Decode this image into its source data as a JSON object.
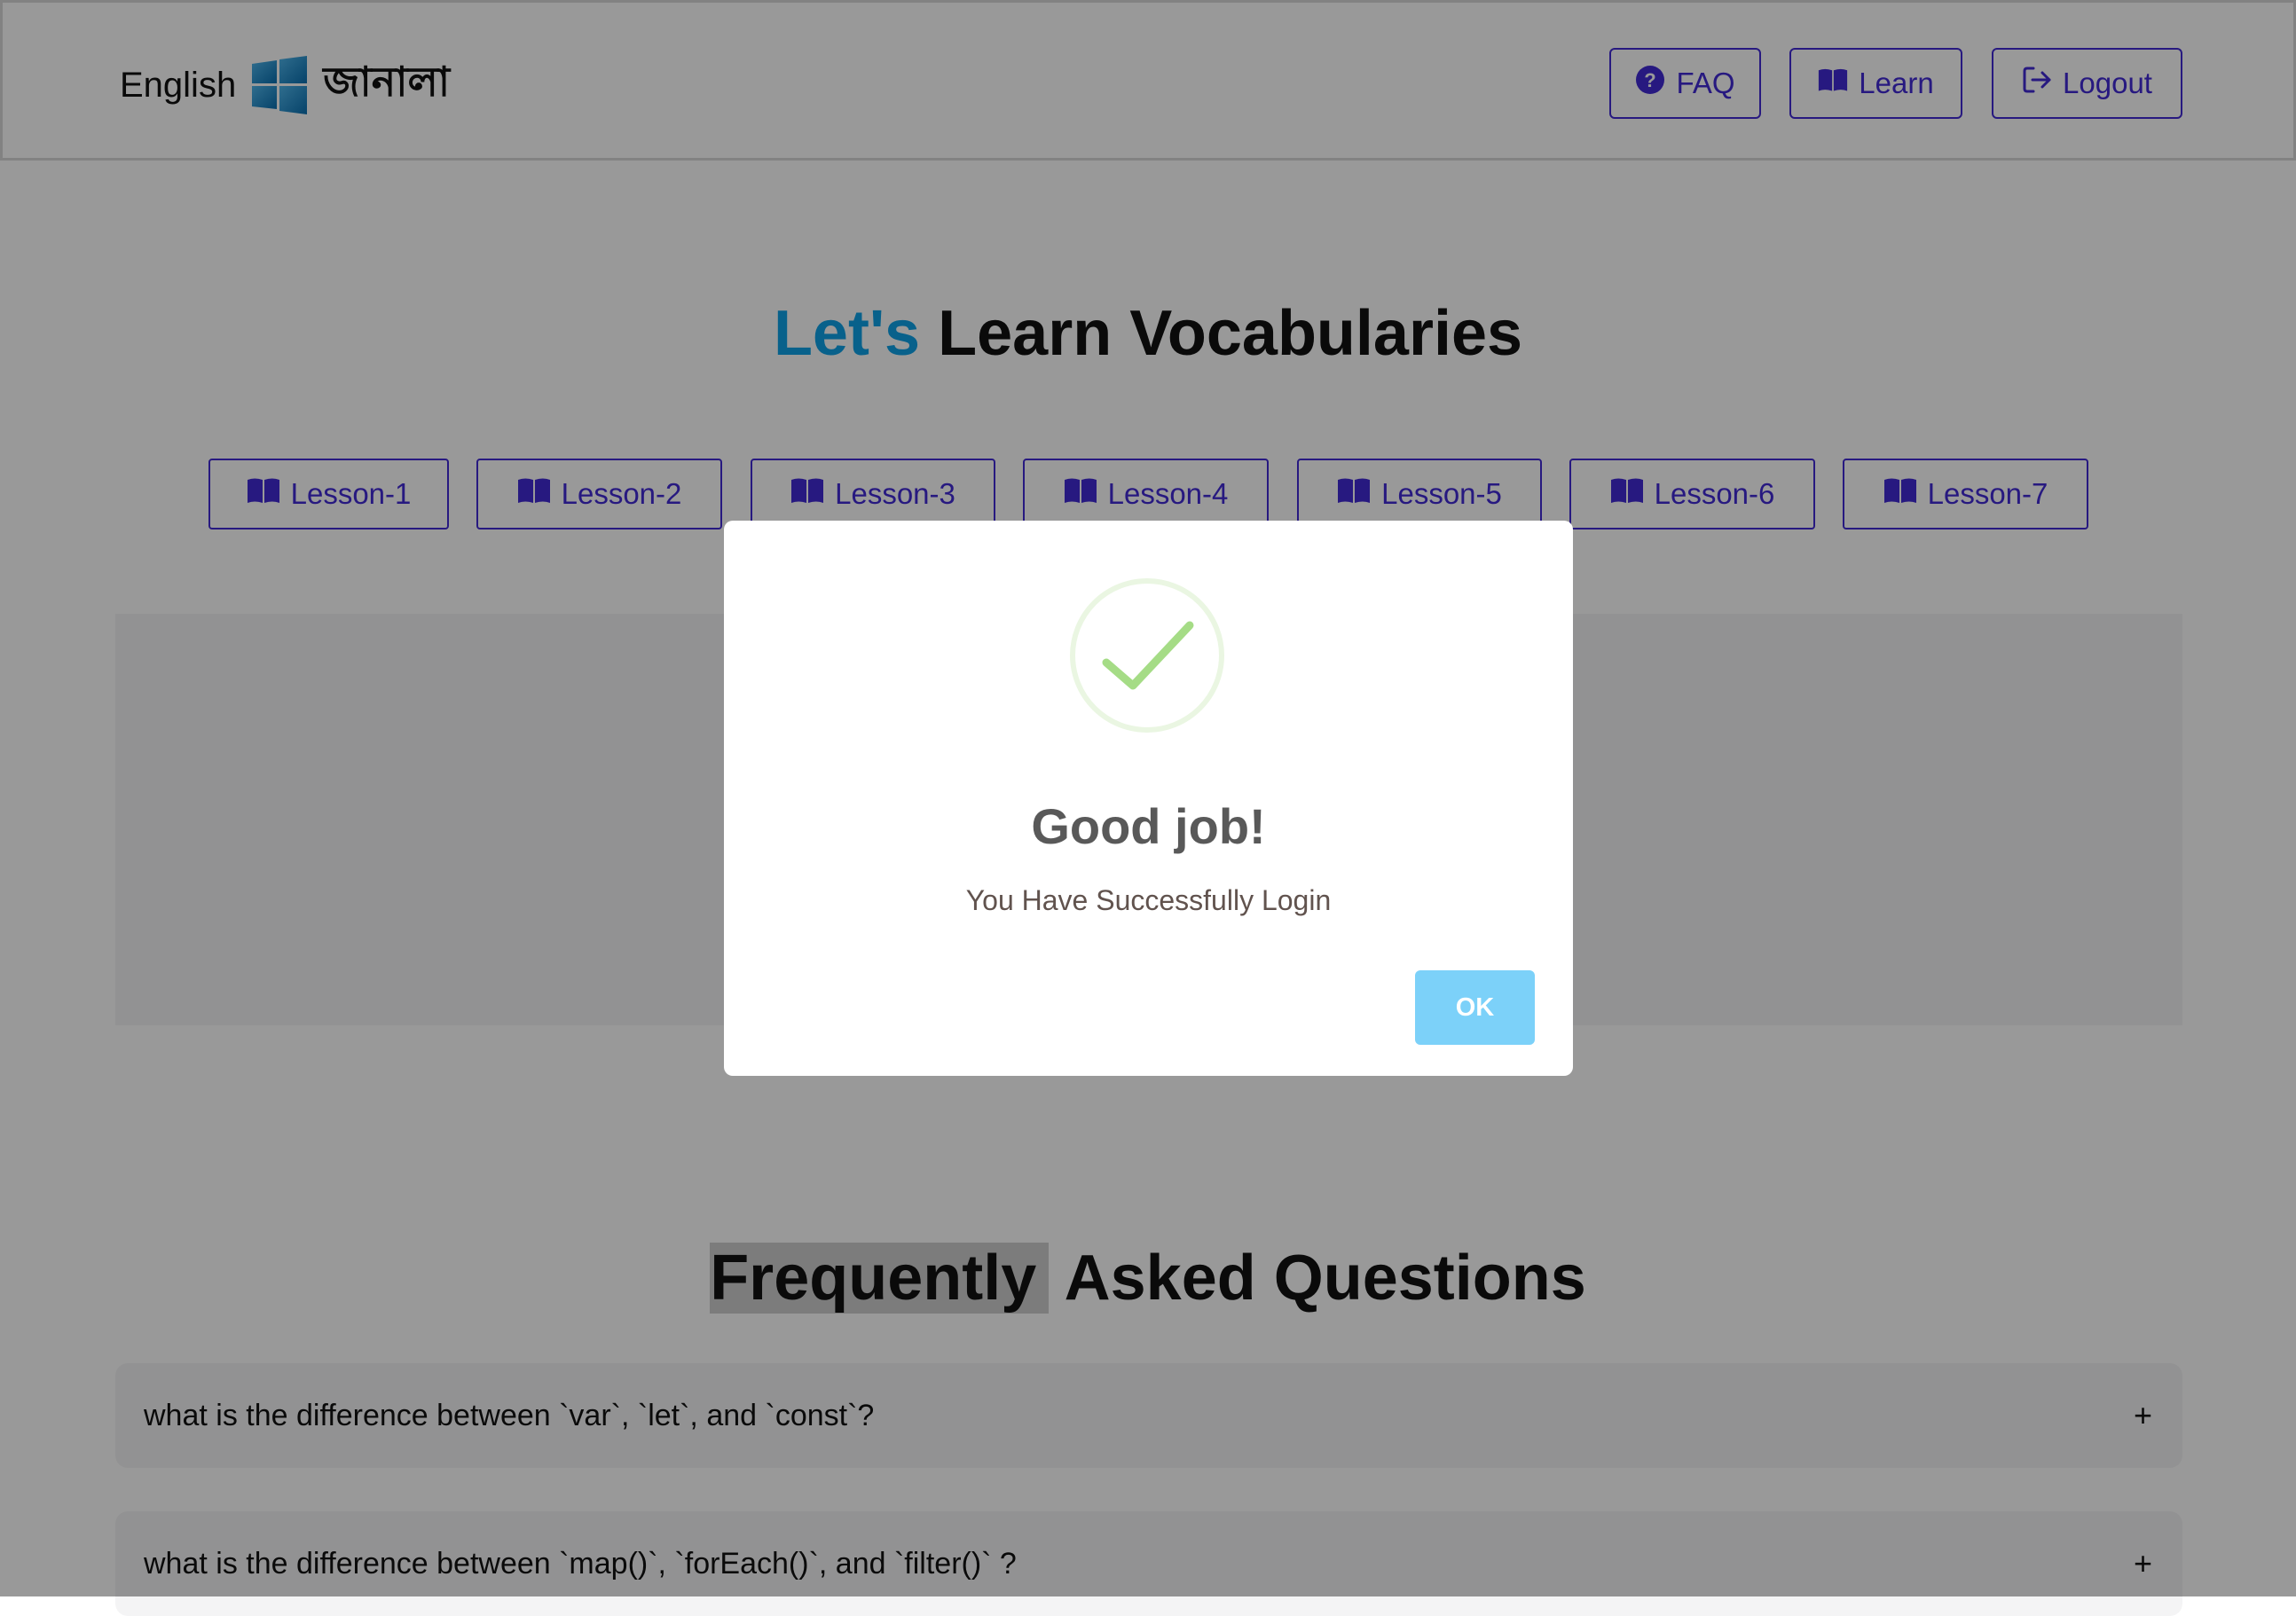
{
  "navbar": {
    "brand_english": "English",
    "brand_bangla": "জানালা",
    "faq_label": "FAQ",
    "learn_label": "Learn",
    "logout_label": "Logout"
  },
  "hero": {
    "title_accent": "Let's",
    "title_rest": "Learn Vocabularies"
  },
  "lessons": [
    {
      "label": "Lesson-1"
    },
    {
      "label": "Lesson-2"
    },
    {
      "label": "Lesson-3"
    },
    {
      "label": "Lesson-4"
    },
    {
      "label": "Lesson-5"
    },
    {
      "label": "Lesson-6"
    },
    {
      "label": "Lesson-7"
    }
  ],
  "faq": {
    "title_highlight": "Frequently",
    "title_rest": "Asked Questions",
    "items": [
      {
        "question": "what is the difference between `var`, `let`, and `const`?",
        "toggle": "+"
      },
      {
        "question": "what is the difference between `map()`, `forEach()`, and `filter()` ?",
        "toggle": "+"
      }
    ]
  },
  "modal": {
    "title": "Good job!",
    "text": "You Have Successfully Login",
    "ok_label": "OK"
  },
  "colors": {
    "primary": "#422ad5",
    "accent": "#0ea2e8",
    "success": "#a5dc86",
    "ok_button": "#7cd1f9"
  },
  "icons": {
    "faq": "question-circle-icon",
    "learn": "book-open-icon",
    "logout": "sign-out-icon",
    "lesson": "book-open-icon",
    "success": "check-circle-icon",
    "brand": "windows-logo-icon"
  }
}
